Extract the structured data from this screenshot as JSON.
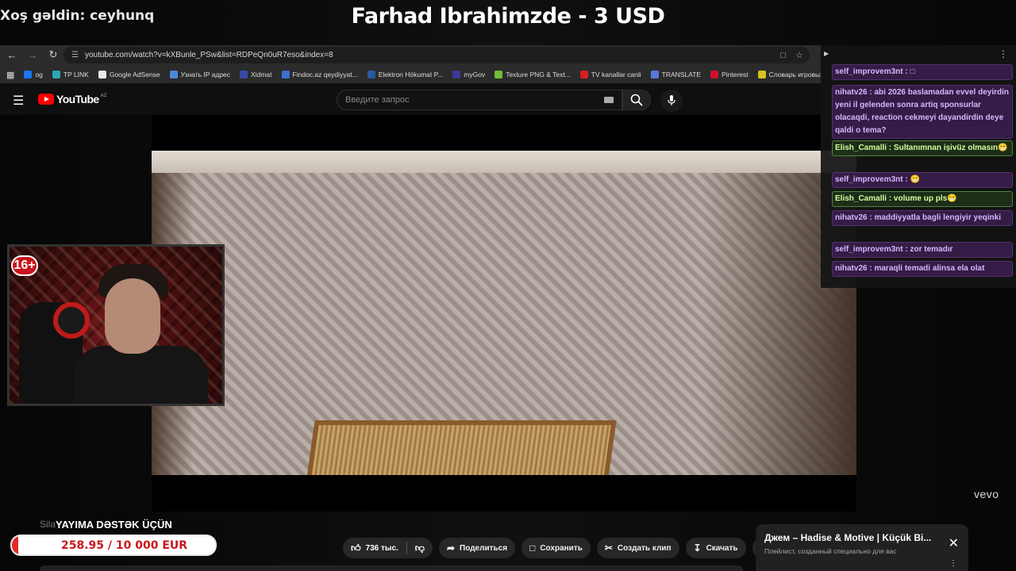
{
  "overlay": {
    "welcome": "Xoş gəldin: ceyhunq",
    "donor": "Farhad Ibrahimzde - 3 USD",
    "age_badge": "16+",
    "goal_label": "YAYIMA DƏSTƏK ÜÇÜN",
    "goal_text": "258.95 / 10 000 EUR",
    "goal_fraction": 0.026
  },
  "browser": {
    "url": "youtube.com/watch?v=kXBunle_PSw&list=RDPeQn0uR7eso&index=8",
    "bookmarks": [
      {
        "label": "og",
        "color": "#1877f2"
      },
      {
        "label": "TP LINK",
        "color": "#2aa8b5"
      },
      {
        "label": "Google AdSense",
        "color": "#e8e8e8"
      },
      {
        "label": "Узнать IP адрес",
        "color": "#4a8bd6"
      },
      {
        "label": "Xidmat",
        "color": "#3a4aa8"
      },
      {
        "label": "Findoc.az qeydiyyat...",
        "color": "#3b6fd0"
      },
      {
        "label": "Elektron Hökumat P...",
        "color": "#2a5aa0"
      },
      {
        "label": "myGov",
        "color": "#3a3a9a"
      },
      {
        "label": "Texture PNG & Text...",
        "color": "#6cbf3a"
      },
      {
        "label": "TV kanallar canli",
        "color": "#d42020"
      },
      {
        "label": "TRANSLATE",
        "color": "#5a7ad8"
      },
      {
        "label": "Pinterest",
        "color": "#d0102a"
      },
      {
        "label": "Словарь игровых т...",
        "color": "#d8c020"
      },
      {
        "label": "2",
        "color": "#888888"
      }
    ]
  },
  "youtube": {
    "logo_text": "YouTube",
    "country": "AZ",
    "search_placeholder": "Введите запрос",
    "watermark": "vevo",
    "video_title": "Sila",
    "likes": "736 тыс.",
    "share": "Поделиться",
    "save": "Сохранить",
    "clip": "Создать клип",
    "download": "Скачать",
    "more": "···",
    "playlist_title": "Джем – Hadise & Motive | Küçük Bi...",
    "playlist_sub": "Плейлист, созданный специально для вас"
  },
  "chat": {
    "messages": [
      {
        "user": "self_improvem3nt",
        "text": "□",
        "style": "purple"
      },
      {
        "user": "nihatv26",
        "text": "abi 2026 baslamadan evvel deyirdin yeni il gelenden sonra artiq sponsurlar olacaqdi, reaction cekmeyi dayandirdin deye qaldi o tema?",
        "style": "purple"
      },
      {
        "user": "Elish_Camalli",
        "text": "Sultanımnan işivüz olmasın😁",
        "style": "green"
      },
      {
        "user": "self_improvem3nt",
        "text": "😬",
        "style": "purple"
      },
      {
        "user": "Elish_Camalli",
        "text": "volume up pls😁",
        "style": "green"
      },
      {
        "user": "nihatv26",
        "text": "maddiyyatla bagli lengiyir yeqinki",
        "style": "purple"
      },
      {
        "user": "self_improvem3nt",
        "text": "zor temadır",
        "style": "purple"
      },
      {
        "user": "nihatv26",
        "text": "maraqli temadi alinsa ela olat",
        "style": "purple"
      }
    ]
  }
}
